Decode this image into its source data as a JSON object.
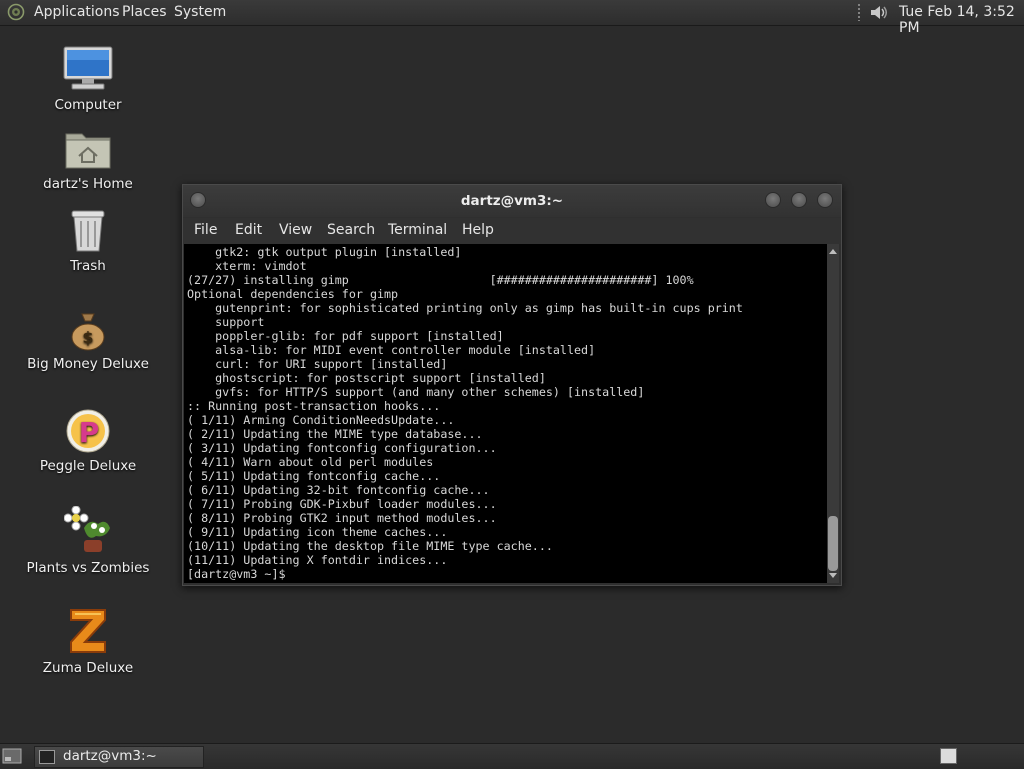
{
  "top_panel": {
    "menus": [
      "Applications",
      "Places",
      "System"
    ],
    "clock": "Tue Feb 14,  3:52 PM"
  },
  "desktop_icons": [
    {
      "label": "Computer",
      "icon": "computer-icon"
    },
    {
      "label": "dartz's Home",
      "icon": "home-folder-icon"
    },
    {
      "label": "Trash",
      "icon": "trash-icon"
    },
    {
      "label": "Big Money Deluxe",
      "icon": "money-bag-icon"
    },
    {
      "label": "Peggle Deluxe",
      "icon": "peggle-icon"
    },
    {
      "label": "Plants vs Zombies",
      "icon": "plants-vs-zombies-icon"
    },
    {
      "label": "Zuma Deluxe",
      "icon": "zuma-icon"
    }
  ],
  "terminal": {
    "title": "dartz@vm3:~",
    "menus": [
      "File",
      "Edit",
      "View",
      "Search",
      "Terminal",
      "Help"
    ],
    "lines": [
      "    gtk2: gtk output plugin [installed]",
      "    xterm: vimdot",
      "(27/27) installing gimp                    [######################] 100%",
      "Optional dependencies for gimp",
      "    gutenprint: for sophisticated printing only as gimp has built-in cups print",
      "    support",
      "    poppler-glib: for pdf support [installed]",
      "    alsa-lib: for MIDI event controller module [installed]",
      "    curl: for URI support [installed]",
      "    ghostscript: for postscript support [installed]",
      "    gvfs: for HTTP/S support (and many other schemes) [installed]",
      ":: Running post-transaction hooks...",
      "( 1/11) Arming ConditionNeedsUpdate...",
      "( 2/11) Updating the MIME type database...",
      "( 3/11) Updating fontconfig configuration...",
      "( 4/11) Warn about old perl modules",
      "( 5/11) Updating fontconfig cache...",
      "( 6/11) Updating 32-bit fontconfig cache...",
      "( 7/11) Probing GDK-Pixbuf loader modules...",
      "( 8/11) Probing GTK2 input method modules...",
      "( 9/11) Updating icon theme caches...",
      "(10/11) Updating the desktop file MIME type cache...",
      "(11/11) Updating X fontdir indices...",
      "[dartz@vm3 ~]$ "
    ]
  },
  "bottom_panel": {
    "taskbar_item": "dartz@vm3:~"
  }
}
